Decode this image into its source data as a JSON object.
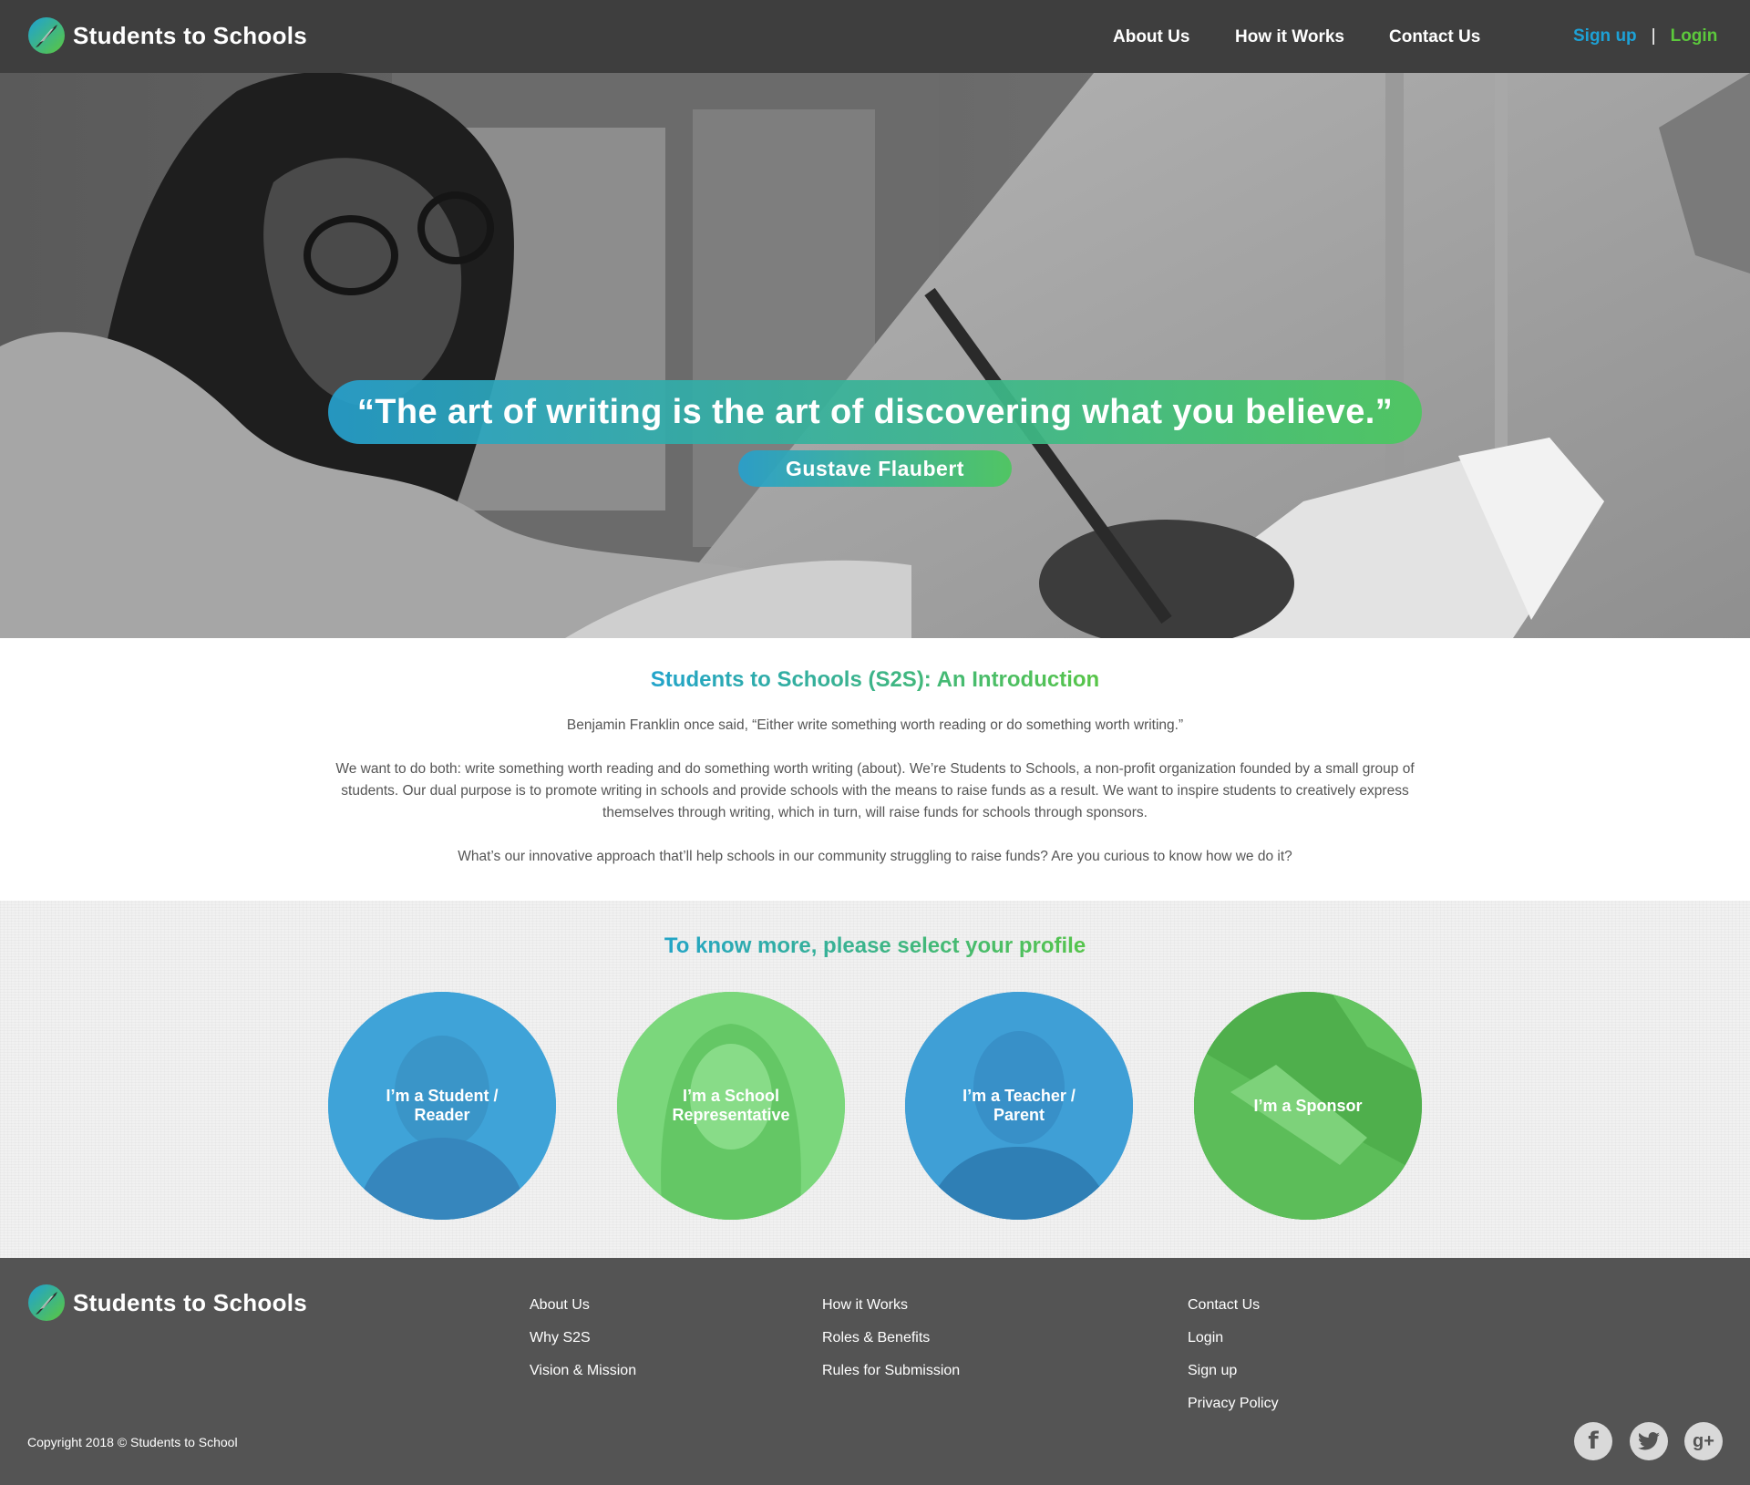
{
  "brand": {
    "name": "Students to Schools"
  },
  "nav": {
    "items": [
      {
        "label": "About Us"
      },
      {
        "label": "How it Works"
      },
      {
        "label": "Contact Us"
      }
    ],
    "signup": "Sign up",
    "separator": "|",
    "login": "Login"
  },
  "hero": {
    "quote": "“The art of writing is the art of discovering what you believe.”",
    "author": "Gustave Flaubert"
  },
  "intro": {
    "title": "Students to Schools (S2S): An Introduction",
    "paragraphs": [
      "Benjamin Franklin once said, “Either write something worth reading or do something worth writing.”",
      "We want to do both: write something worth reading and do something worth writing (about). We’re Students to Schools, a non-profit organization founded by a small group of students. Our dual purpose is to promote writing in schools and provide schools with the means to raise funds as a result. We want to inspire students to creatively express themselves through writing, which in turn, will raise funds for schools through sponsors.",
      "What’s our innovative approach that’ll help schools in our community struggling to raise funds? Are you curious to know how we do it?"
    ]
  },
  "profile": {
    "title": "To know more, please select your profile",
    "options": [
      {
        "label": "I’m a Student /\nReader",
        "color": "#3fa3d8"
      },
      {
        "label": "I’m a School\nRepresentative",
        "color": "#6fd070"
      },
      {
        "label": "I’m a Teacher /\nParent",
        "color": "#3b93cd"
      },
      {
        "label": "I’m a Sponsor",
        "color": "#52b84f"
      }
    ]
  },
  "footer": {
    "columns": [
      [
        "About Us",
        "Why S2S",
        "Vision & Mission"
      ],
      [
        "How it Works",
        "Roles & Benefits",
        "Rules for Submission"
      ],
      [
        "Contact Us",
        "Login",
        "Sign up",
        "Privacy Policy"
      ]
    ],
    "copyright": "Copyright 2018 ©  Students to School",
    "social": [
      {
        "icon": "facebook-icon",
        "glyph": "f"
      },
      {
        "icon": "twitter-icon",
        "glyph": ""
      },
      {
        "icon": "google-plus-icon",
        "glyph": "g+"
      }
    ]
  },
  "colors": {
    "blue": "#1da1d6",
    "green": "#5cc83c",
    "header_bg": "#3e3e3e",
    "footer_bg": "#545454"
  }
}
